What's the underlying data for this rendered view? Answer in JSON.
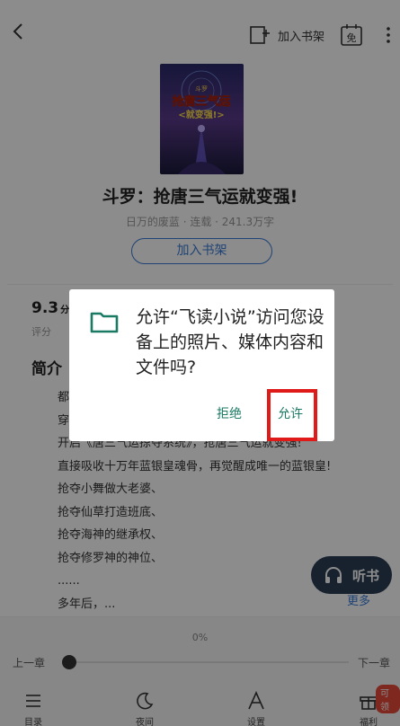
{
  "topbar": {
    "add_shelf_label": "加入书架",
    "free_badge": "免"
  },
  "book": {
    "cover_title_line1": "抢唐三气运",
    "cover_subtitle": "<就变强!>",
    "cover_tag": "斗罗",
    "title": "斗罗：抢唐三气运就变强!",
    "meta": "日万的废蓝 · 连载 · 241.3万字",
    "add_shelf_button": "加入书架",
    "score": "9.3",
    "score_unit": "分",
    "score_label": "评分",
    "intro_heading": "简介",
    "intro_lines": [
      "都",
      "穿",
      "开启《唐三气运掠夺系统》，抢唐三气运就变强!",
      "直接吸收十万年蓝银皇魂骨，再觉醒成唯一的蓝银皇!",
      "抢夺小舞做大老婆、",
      "抢夺仙草打造班底、",
      "抢夺海神的继承权、",
      "抢夺修罗神的神位、",
      "......",
      "多年后，..."
    ],
    "more_link": "更多"
  },
  "listen_button": "听书",
  "reader": {
    "progress_percent": "0%",
    "progress_value": 0,
    "prev_chapter": "上一章",
    "next_chapter": "下一章",
    "tabs": [
      {
        "label": "目录",
        "icon": "list-icon"
      },
      {
        "label": "夜间",
        "icon": "moon-icon"
      },
      {
        "label": "设置",
        "icon": "font-icon"
      },
      {
        "label": "福利",
        "icon": "gift-icon"
      }
    ],
    "welfare_badge": "可领"
  },
  "dialog": {
    "message": "允许“飞读小说”访问您设备上的照片、媒体内容和文件吗?",
    "deny": "拒绝",
    "allow": "允许"
  },
  "colors": {
    "accent_blue": "#3a7bd5",
    "dialog_button_green": "#1a7a63",
    "folder_teal": "#1a7a63",
    "highlight_red": "#e01919",
    "listen_bg": "#2c3e55"
  }
}
